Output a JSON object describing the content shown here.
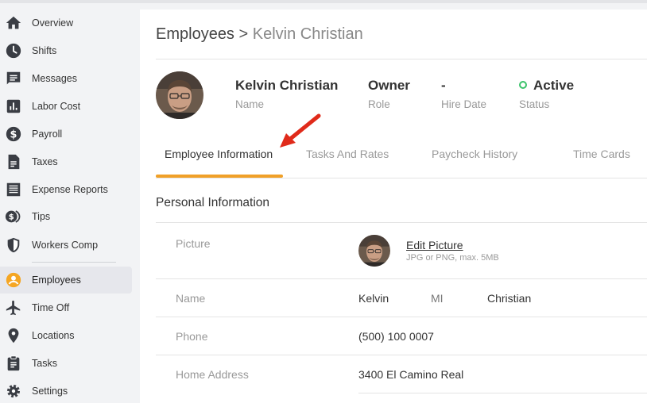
{
  "sidebar": {
    "items": [
      {
        "label": "Overview",
        "icon": "home-icon"
      },
      {
        "label": "Shifts",
        "icon": "clock-icon"
      },
      {
        "label": "Messages",
        "icon": "message-icon"
      },
      {
        "label": "Labor Cost",
        "icon": "bar-chart-icon"
      },
      {
        "label": "Payroll",
        "icon": "dollar-icon"
      },
      {
        "label": "Taxes",
        "icon": "document-icon"
      },
      {
        "label": "Expense Reports",
        "icon": "receipt-icon"
      },
      {
        "label": "Tips",
        "icon": "coins-icon"
      },
      {
        "label": "Workers Comp",
        "icon": "shield-icon"
      },
      {
        "label": "Employees",
        "icon": "person-circle-icon",
        "active": true
      },
      {
        "label": "Time Off",
        "icon": "airplane-icon"
      },
      {
        "label": "Locations",
        "icon": "location-pin-icon"
      },
      {
        "label": "Tasks",
        "icon": "clipboard-icon"
      },
      {
        "label": "Settings",
        "icon": "gear-icon"
      }
    ]
  },
  "breadcrumb": {
    "parent": "Employees",
    "separator": ">",
    "current": "Kelvin Christian"
  },
  "employee": {
    "name_value": "Kelvin Christian",
    "name_label": "Name",
    "role_value": "Owner",
    "role_label": "Role",
    "hire_value": "-",
    "hire_label": "Hire Date",
    "status_value": "Active",
    "status_label": "Status"
  },
  "tabs": [
    {
      "label": "Employee Information",
      "active": true
    },
    {
      "label": "Tasks And Rates"
    },
    {
      "label": "Paycheck History"
    },
    {
      "label": "Time Cards"
    }
  ],
  "personal": {
    "title": "Personal Information",
    "picture_label": "Picture",
    "edit_picture": "Edit Picture",
    "picture_hint": "JPG or PNG, max. 5MB",
    "name_label": "Name",
    "first_name": "Kelvin",
    "middle_initial": "MI",
    "last_name": "Christian",
    "phone_label": "Phone",
    "phone": "(500) 100 0007",
    "address_label": "Home Address",
    "address": "3400 El Camino Real"
  },
  "colors": {
    "accent_tab": "#f0a028",
    "status_active": "#3cc36b",
    "annotation_arrow": "#e02a1a",
    "employees_icon": "#f5a623"
  }
}
